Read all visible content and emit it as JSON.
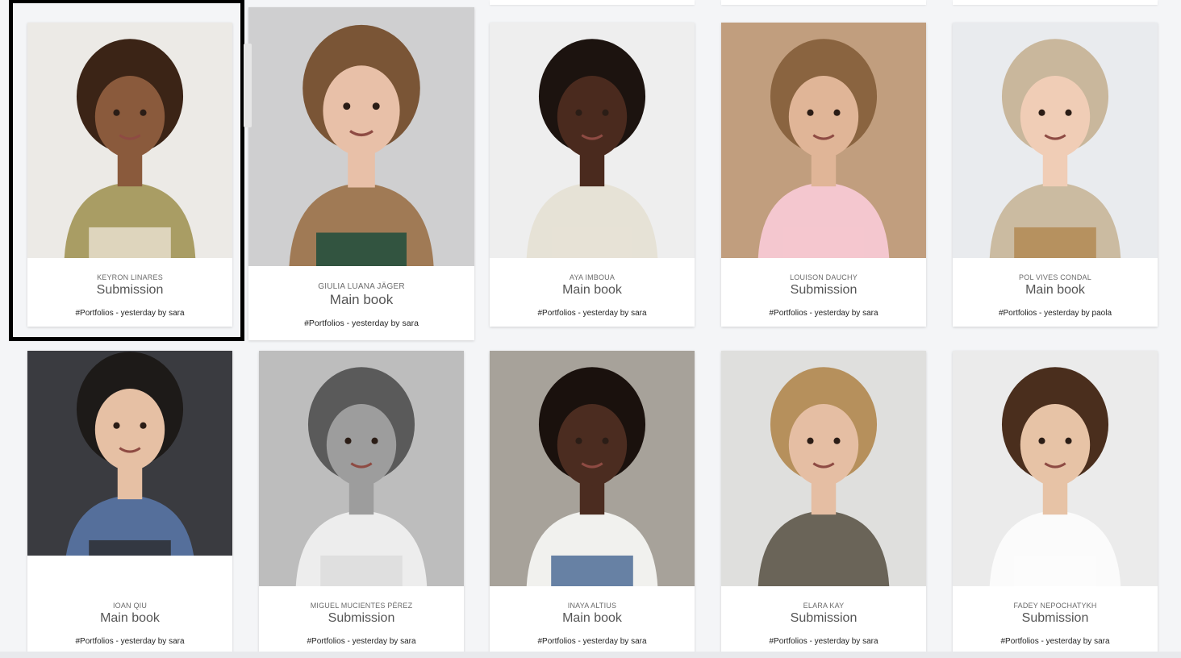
{
  "cards": [
    {
      "name": "KEYRON LINARES",
      "book": "Submission",
      "meta": "#Portfolios - yesterday by sara",
      "photo": "photo-toddler-olive-tshirt",
      "bg": "#eceae6",
      "skin": "#8a5a3c",
      "hair": "#3b2416",
      "top": "#a99d64",
      "bottom": "#e8dfcc"
    },
    {
      "name": "GIULIA LUANA JÄGER",
      "book": "Main book",
      "meta": "#Portfolios - yesterday by sara",
      "photo": "photo-girl-teddy-coat",
      "bg": "#cfcfd0",
      "skin": "#e8c0a8",
      "hair": "#7a5536",
      "top": "#a07a55",
      "bottom": "#1f4e3d"
    },
    {
      "name": "AYA IMBOUA",
      "book": "Main book",
      "meta": "#Portfolios - yesterday by sara",
      "photo": "photo-girl-curly-hair",
      "bg": "#eeeeee",
      "skin": "#4a2a1e",
      "hair": "#1c130f",
      "top": "#e6e2d6",
      "bottom": "#e6e2d6"
    },
    {
      "name": "LOUISON DAUCHY",
      "book": "Submission",
      "meta": "#Portfolios - yesterday by sara",
      "photo": "photo-girl-stay-cool-tee",
      "bg": "#c19e7e",
      "skin": "#e0b597",
      "hair": "#8a6440",
      "top": "#f4c7cf",
      "bottom": "#f4c7cf"
    },
    {
      "name": "POL VIVES CONDAL",
      "book": "Main book",
      "meta": "#Portfolios - yesterday by paola",
      "photo": "photo-baby-knit-hat",
      "bg": "#e9ebee",
      "skin": "#f0cdb6",
      "hair": "#c9b79c",
      "top": "#cbbba1",
      "bottom": "#b38a54"
    },
    {
      "name": "IOAN QIU",
      "book": "Main book",
      "meta": "#Portfolios - yesterday by sara",
      "photo": "photo-toddler-blue-shirt",
      "bg": "#3a3b40",
      "skin": "#e6c0a4",
      "hair": "#1d1a18",
      "top": "#556f9b",
      "bottom": "#2e2f33"
    },
    {
      "name": "MIGUEL MUCIENTES PÉREZ",
      "book": "Submission",
      "meta": "#Portfolios - yesterday by sara",
      "photo": "photo-baby-black-white",
      "bg": "#bdbdbd",
      "skin": "#9d9d9d",
      "hair": "#5a5a5a",
      "top": "#ededed",
      "bottom": "#dcdcdc"
    },
    {
      "name": "INAYA ALTIUS",
      "book": "Main book",
      "meta": "#Portfolios - yesterday by sara",
      "photo": "photo-girl-street-nyc",
      "bg": "#a7a29a",
      "skin": "#4b2c20",
      "hair": "#1a110d",
      "top": "#f1f1ee",
      "bottom": "#4f6d96"
    },
    {
      "name": "ELARA KAY",
      "book": "Submission",
      "meta": "#Portfolios - yesterday by sara",
      "photo": "photo-girl-blonde-hair",
      "bg": "#dfdfdd",
      "skin": "#e5bea3",
      "hair": "#b6905c",
      "top": "#6a6458",
      "bottom": "#6a6458"
    },
    {
      "name": "FADEY NEPOCHATYKH",
      "book": "Submission",
      "meta": "#Portfolios - yesterday by sara",
      "photo": "photo-boy-white-tee",
      "bg": "#ebebeb",
      "skin": "#e7c3a6",
      "hair": "#4a2e1d",
      "top": "#fbfbfb",
      "bottom": "#fbfbfb"
    }
  ]
}
